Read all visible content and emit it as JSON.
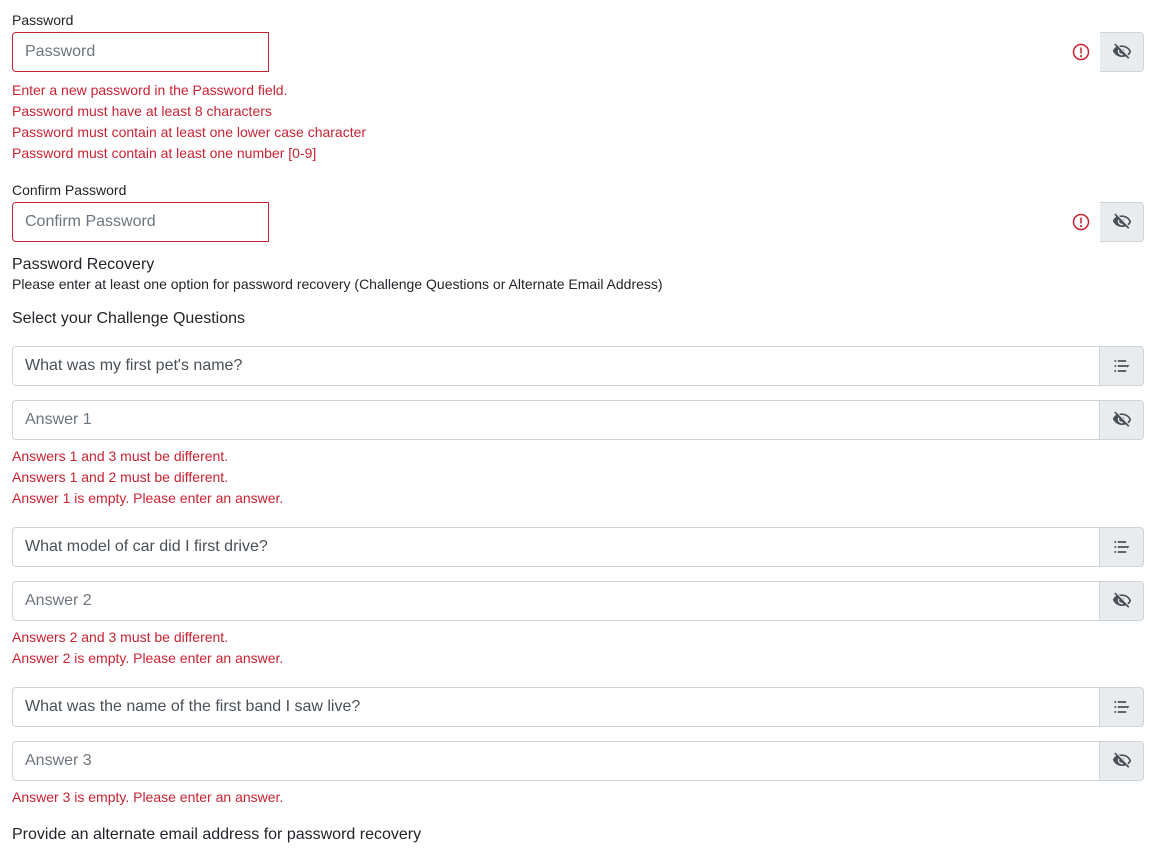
{
  "password": {
    "label": "Password",
    "placeholder": "Password",
    "errors": [
      "Enter a new password in the Password field.",
      "Password must have at least 8 characters",
      "Password must contain at least one lower case character",
      "Password must contain at least one number [0-9]"
    ]
  },
  "confirm_password": {
    "label": "Confirm Password",
    "placeholder": "Confirm Password"
  },
  "recovery": {
    "heading": "Password Recovery",
    "subtext": "Please enter at least one option for password recovery (Challenge Questions or Alternate Email Address)"
  },
  "challenge": {
    "heading": "Select your Challenge Questions",
    "questions": [
      {
        "text": "What was my first pet's name?",
        "answer_placeholder": "Answer 1",
        "errors": [
          "Answers 1 and 3 must be different.",
          "Answers 1 and 2 must be different.",
          "Answer 1 is empty. Please enter an answer."
        ]
      },
      {
        "text": "What model of car did I first drive?",
        "answer_placeholder": "Answer 2",
        "errors": [
          "Answers 2 and 3 must be different.",
          "Answer 2 is empty. Please enter an answer."
        ]
      },
      {
        "text": "What was the name of the first band I saw live?",
        "answer_placeholder": "Answer 3",
        "errors": [
          "Answer 3 is empty. Please enter an answer."
        ]
      }
    ]
  },
  "alt_email": {
    "heading": "Provide an alternate email address for password recovery"
  }
}
